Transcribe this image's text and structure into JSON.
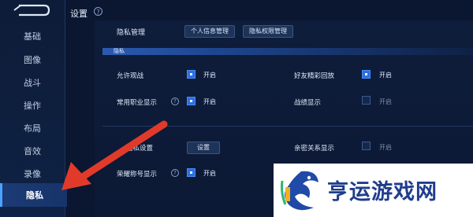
{
  "header": {
    "title": "设置",
    "help_glyph": "?"
  },
  "sidebar": {
    "items": [
      {
        "label": "基础"
      },
      {
        "label": "图像"
      },
      {
        "label": "战斗"
      },
      {
        "label": "操作"
      },
      {
        "label": "布局"
      },
      {
        "label": "音效"
      },
      {
        "label": "录像"
      },
      {
        "label": "隐私",
        "active": true
      }
    ]
  },
  "privacy_management": {
    "label": "隐私管理",
    "personal_info_button": "个人信息管理",
    "permission_button": "隐私权限管理"
  },
  "section": {
    "title": "隐私"
  },
  "options": {
    "allow_spectate": {
      "label": "允许观战",
      "checked": true,
      "state_label": "开启"
    },
    "friend_highlights": {
      "label": "好友精彩回放",
      "checked": true,
      "state_label": "开启"
    },
    "common_roles": {
      "label": "常用职业显示",
      "checked": true,
      "state_label": "开启",
      "help_glyph": "?"
    },
    "battle_record": {
      "label": "战绩显示",
      "checked": false,
      "state_label": "开启"
    },
    "privacy_settings": {
      "label": "隐私设置",
      "button": "设置"
    },
    "intimate_relation": {
      "label": "亲密关系显示",
      "checked": false,
      "state_label": "开启"
    },
    "honor_title": {
      "label": "荣耀称号显示",
      "checked": true,
      "state_label": "开启",
      "help_glyph": "?"
    }
  },
  "watermark": {
    "text": "亨运游戏网"
  },
  "colors": {
    "accent": "#2b6fe0",
    "arrow": "#e23a2a",
    "panel_bg": "#0e1d3b"
  }
}
